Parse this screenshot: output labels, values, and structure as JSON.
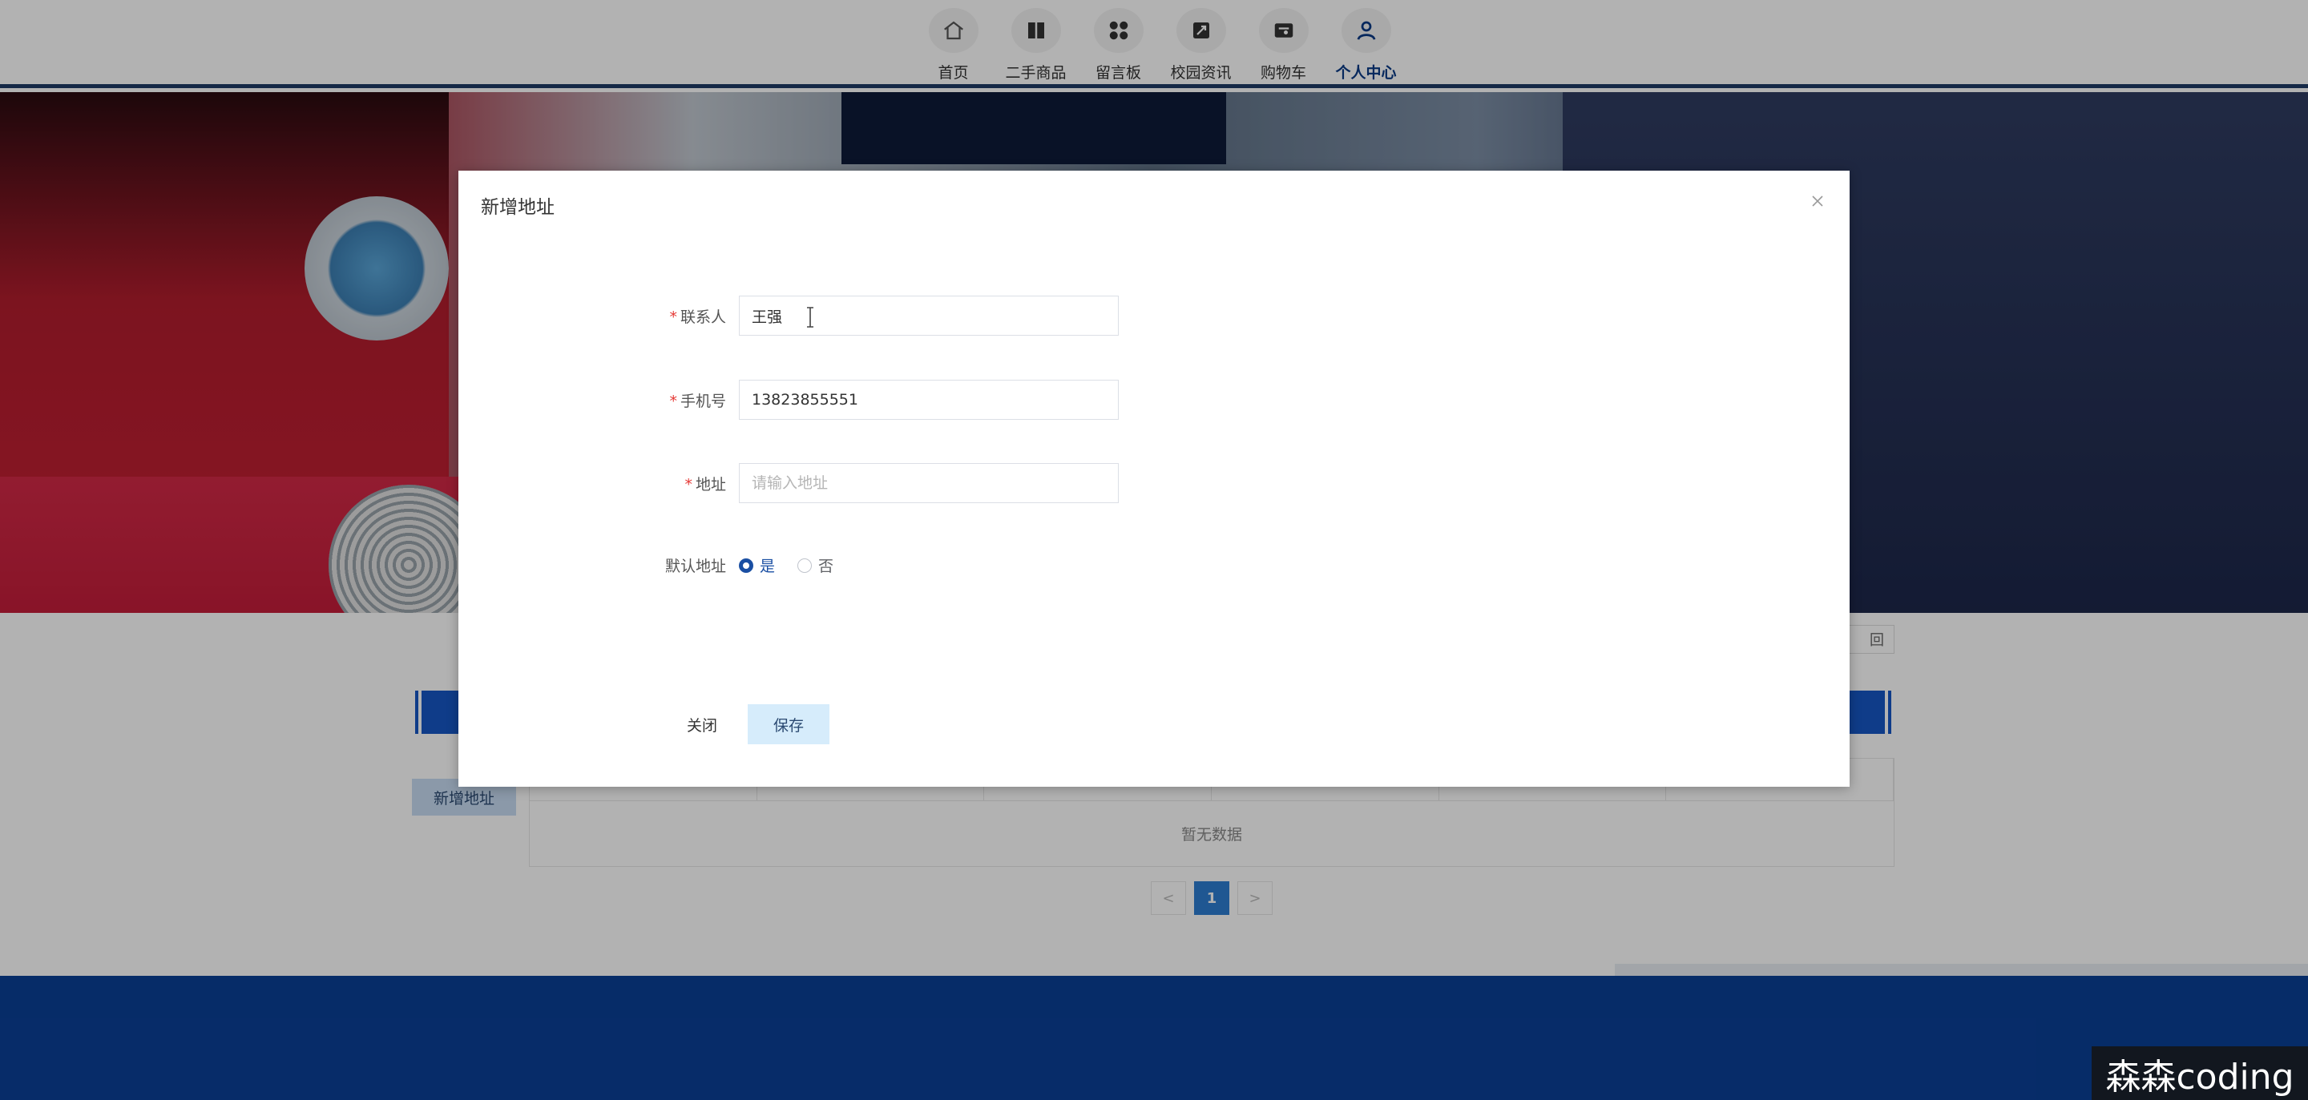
{
  "nav": {
    "items": [
      {
        "label": "首页",
        "icon": "home-icon"
      },
      {
        "label": "二手商品",
        "icon": "goods-icon"
      },
      {
        "label": "留言板",
        "icon": "message-board-icon"
      },
      {
        "label": "校园资讯",
        "icon": "news-icon"
      },
      {
        "label": "购物车",
        "icon": "cart-icon"
      },
      {
        "label": "个人中心",
        "icon": "user-icon",
        "active": true
      }
    ]
  },
  "content": {
    "return_label": "回",
    "add_address_label": "新增地址",
    "empty_text": "暂无数据",
    "pager": {
      "prev": "<",
      "current": "1",
      "next": ">"
    }
  },
  "dialog": {
    "title": "新增地址",
    "fields": {
      "contact": {
        "label": "联系人",
        "required": "*",
        "value": "王强"
      },
      "phone": {
        "label": "手机号",
        "required": "*",
        "value": "13823855551"
      },
      "address": {
        "label": "地址",
        "required": "*",
        "value": "",
        "placeholder": "请输入地址"
      },
      "default": {
        "label": "默认地址",
        "options": [
          "是",
          "否"
        ],
        "selected": "是"
      }
    },
    "buttons": {
      "close": "关闭",
      "save": "保存"
    }
  },
  "watermark": {
    "text": "森森coding"
  },
  "colors": {
    "primary": "#1a4fa3",
    "nav_active": "#0a3a86",
    "footer": "#0a3f96",
    "required": "#e53935"
  }
}
